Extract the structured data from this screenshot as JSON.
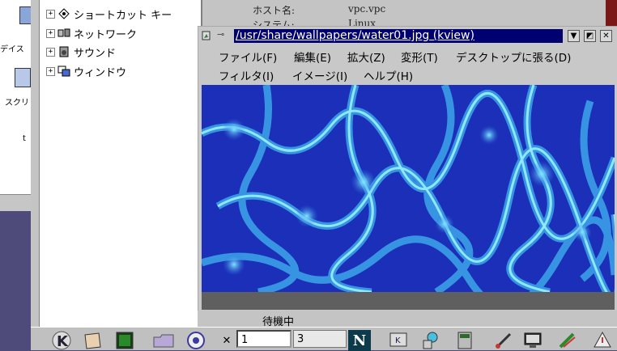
{
  "desktop": {
    "labels": [
      "デイス",
      "スクリ",
      "t"
    ]
  },
  "control_center": {
    "tree_items": [
      {
        "label": "ショートカット キー",
        "expander": "+"
      },
      {
        "label": "ネットワーク",
        "expander": "+"
      },
      {
        "label": "サウンド",
        "expander": "+"
      },
      {
        "label": "ウィンドウ",
        "expander": "+"
      }
    ],
    "info": [
      {
        "key": "ホスト名:",
        "value": "vpc.vpc"
      },
      {
        "key": "システム:",
        "value": "Linux"
      }
    ]
  },
  "kview": {
    "title": "/usr/share/wallpapers/water01.jpg (kview)",
    "titlebar_buttons": [
      "▼",
      "◩",
      "✕"
    ],
    "menu_row1": [
      "ファイル(F)",
      "編集(E)",
      "拡大(Z)",
      "変形(T)",
      "デスクトップに張る(D)"
    ],
    "menu_row2": [
      "フィルタ(I)",
      "イメージ(I)",
      "ヘルプ(H)"
    ],
    "status": "待機中"
  },
  "taskbar": {
    "pager": [
      "1",
      "3"
    ],
    "icons": [
      "kde-menu-icon",
      "window-list-icon",
      "terminal-icon",
      "folder-icon",
      "home-icon",
      "netscape-icon",
      "kde-app-icon",
      "network-icon",
      "calculator-icon",
      "paint-icon",
      "monitor-icon",
      "editor-icon",
      "tools-icon"
    ],
    "netscape_letter": "N",
    "kde_letter": "K"
  },
  "colors": {
    "title_bg": "#000070",
    "water_dark": "#1b2fb8",
    "water_light": "#4fc3f7",
    "taskbar": "#c0c0c0"
  }
}
